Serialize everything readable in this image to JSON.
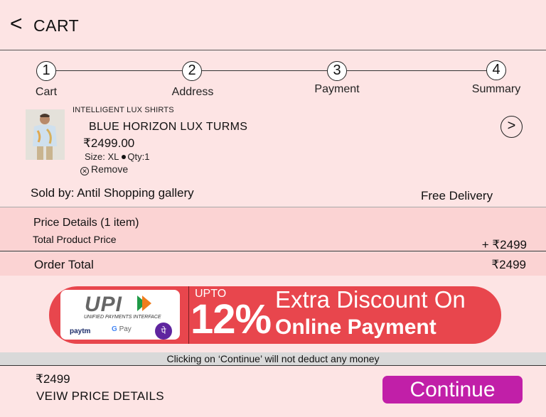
{
  "header": {
    "back_glyph": "<",
    "title": "CART"
  },
  "stepper": {
    "steps": [
      {
        "number": "1",
        "label": "Cart"
      },
      {
        "number": "2",
        "label": "Address"
      },
      {
        "number": "3",
        "label": "Payment"
      },
      {
        "number": "4",
        "label": "Summary"
      }
    ]
  },
  "product": {
    "brand": "INTELLIGENT LUX SHIRTS",
    "name": "BLUE HORIZON LUX TURMS",
    "price": "₹2499.00",
    "size": "Size: XL",
    "qty": "Qty:1",
    "remove_label": "Remove",
    "open_glyph": ">",
    "seller": "Sold by: Antil Shopping gallery",
    "delivery": "Free Delivery"
  },
  "price_details": {
    "title": "Price Details (1 item)",
    "total_product_label": "Total Product Price",
    "total_product_value": "+ ₹2499",
    "order_total_label": "Order Total",
    "order_total_value": "₹2499"
  },
  "banner": {
    "upi_logo": "UPI",
    "upi_subtitle": "UNIFIED PAYMENTS INTERFACE",
    "paytm": "paytm",
    "gpay": "Pay",
    "gpay_g": "G",
    "phonepe": "पे",
    "upto": "UPTO",
    "percent": "12%",
    "line1": "Extra Discount On",
    "line2": "Online Payment",
    "color": "#e8464d"
  },
  "note": "Clicking on ‘Continue’ will not deduct any money",
  "footer": {
    "total": "₹2499",
    "view_details": "VEIW PRICE DETAILS",
    "continue_label": "Continue",
    "continue_color": "#c11fa8"
  },
  "colors": {
    "background": "#fde4e4",
    "price_box": "#fbd3d3"
  }
}
